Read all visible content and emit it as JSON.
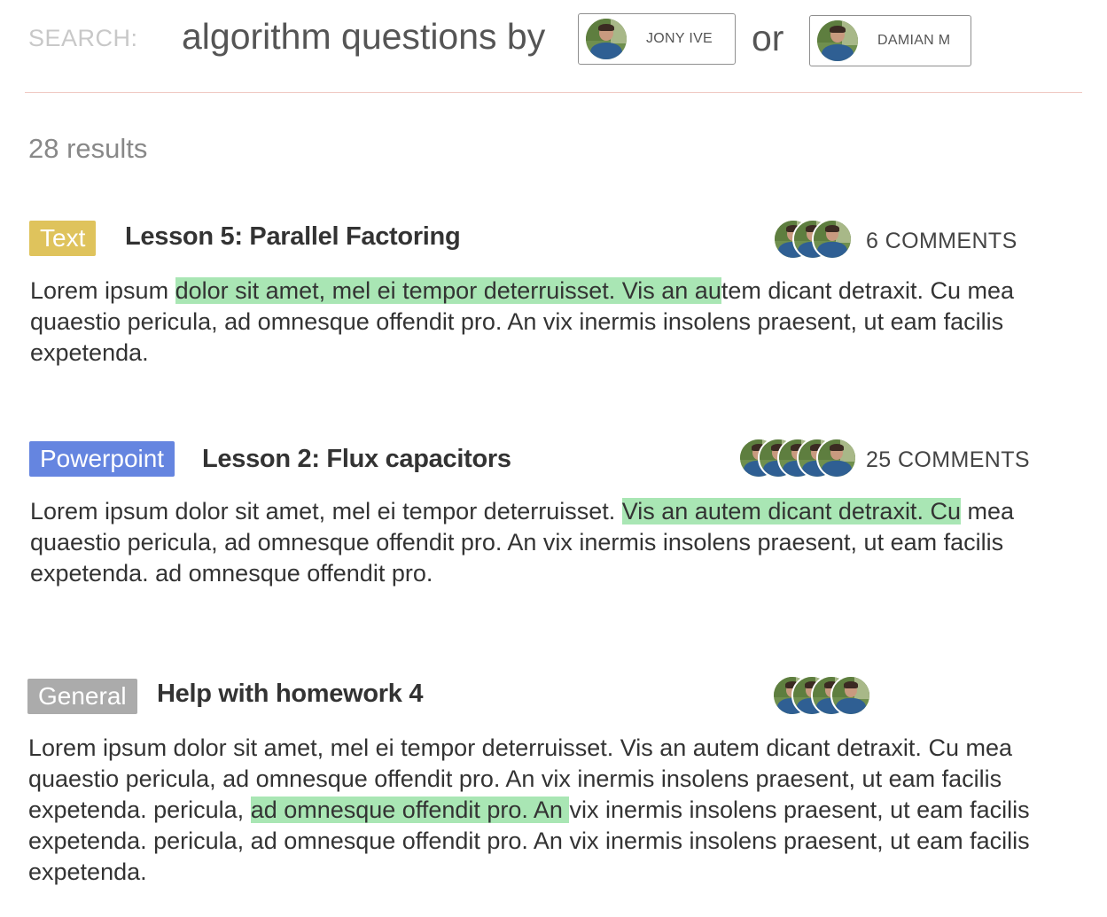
{
  "search": {
    "label": "SEARCH:",
    "query": "algorithm questions by",
    "or": "or",
    "authors": [
      {
        "name": "JONY IVE"
      },
      {
        "name": "DAMIAN M"
      }
    ]
  },
  "results_count": "28 results",
  "results": [
    {
      "badge": "Text",
      "badge_color": "#dfc35c",
      "title": "Lesson 5: Parallel Factoring",
      "comments": "6 COMMENTS",
      "avatar_count": 3,
      "snippet": {
        "before": "Lorem ipsum ",
        "highlight": "dolor sit amet, mel ei tempor deterruisset. Vis an au",
        "after": "tem dicant detraxit. Cu mea quaestio pericula, ad omnesque offendit pro. An vix inermis insolens praesent, ut eam facilis expetenda."
      }
    },
    {
      "badge": "Powerpoint",
      "badge_color": "#6585e0",
      "title": "Lesson 2: Flux capacitors",
      "comments": "25 COMMENTS",
      "avatar_count": 5,
      "snippet": {
        "before": "Lorem ipsum dolor sit amet, mel ei tempor deterruisset. ",
        "highlight": "Vis an autem dicant detraxit. Cu",
        "after": " mea quaestio pericula, ad omnesque offendit pro. An vix inermis insolens praesent, ut eam facilis expetenda. ad omnesque offendit pro."
      }
    },
    {
      "badge": "General",
      "badge_color": "#ababab",
      "title": "Help with homework 4",
      "comments": "",
      "avatar_count": 4,
      "snippet": {
        "before": "Lorem ipsum dolor sit amet, mel ei tempor deterruisset. Vis an autem dicant detraxit. Cu mea quaestio pericula, ad omnesque offendit pro. An vix inermis insolens praesent, ut eam facilis expetenda. pericula, ",
        "highlight": "ad omnesque offendit pro. An ",
        "after": "vix inermis insolens praesent, ut eam facilis expetenda. pericula, ad omnesque offendit pro. An vix inermis insolens praesent, ut eam facilis expetenda."
      }
    }
  ]
}
